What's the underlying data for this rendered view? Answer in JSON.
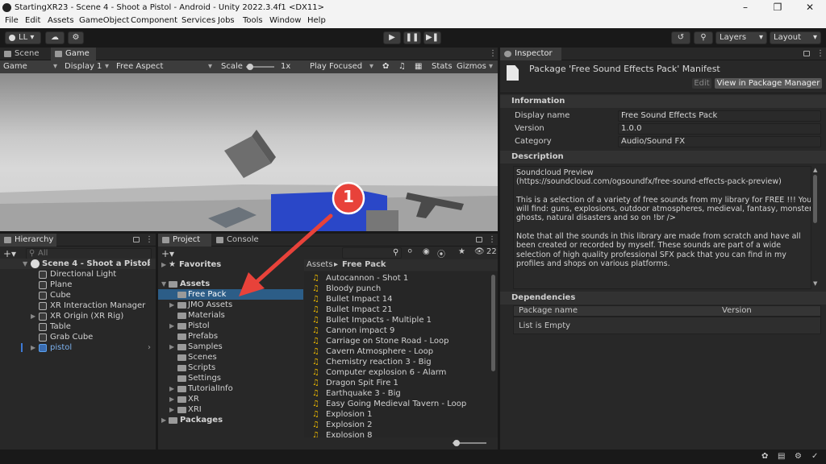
{
  "window": {
    "title": "StartingXR23 - Scene 4 - Shoot a Pistol - Android - Unity 2022.3.4f1 <DX11>"
  },
  "menu": [
    "File",
    "Edit",
    "Assets",
    "GameObject",
    "Component",
    "Services",
    "Jobs",
    "Tools",
    "Window",
    "Help"
  ],
  "toolbar": {
    "account": "LL",
    "layers": "Layers",
    "layout": "Layout"
  },
  "scene_tabs": {
    "scene": "Scene",
    "game": "Game"
  },
  "game_bar": {
    "mode": "Game",
    "display": "Display 1",
    "aspect": "Free Aspect",
    "scale_label": "Scale",
    "scale_value": "1x",
    "play_mode": "Play Focused",
    "stats": "Stats",
    "gizmos": "Gizmos"
  },
  "annotation": {
    "number": "1"
  },
  "hierarchy": {
    "tab": "Hierarchy",
    "search_placeholder": "All",
    "scene": "Scene 4 - Shoot a Pistol",
    "items": [
      "Directional Light",
      "Plane",
      "Cube",
      "XR Interaction Manager",
      "XR Origin (XR Rig)",
      "Table",
      "Grab Cube",
      "pistol"
    ]
  },
  "project": {
    "tabs": [
      "Project",
      "Console"
    ],
    "favorites": "Favorites",
    "assets": "Assets",
    "folders": [
      "Free Pack",
      "JMO Assets",
      "Materials",
      "Pistol",
      "Prefabs",
      "Samples",
      "Scenes",
      "Scripts",
      "Settings",
      "TutorialInfo",
      "XR",
      "XRI"
    ],
    "packages": "Packages",
    "breadcrumb": [
      "Assets",
      "Free Pack"
    ],
    "hidden_count": "22",
    "files": [
      "Autocannon - Shot 1",
      "Bloody punch",
      "Bullet Impact 14",
      "Bullet Impact 21",
      "Bullet Impacts - Multiple 1",
      "Cannon impact 9",
      "Carriage on Stone Road - Loop",
      "Cavern Atmosphere - Loop",
      "Chemistry reaction 3 - Big",
      "Computer explosion 6 - Alarm",
      "Dragon Spit Fire 1",
      "Earthquake 3 - Big",
      "Easy Going Medieval Tavern - Loop",
      "Explosion 1",
      "Explosion 2",
      "Explosion 8"
    ]
  },
  "inspector": {
    "tab": "Inspector",
    "header": "Package 'Free Sound Effects Pack' Manifest",
    "edit": "Edit",
    "view_pm": "View in Package Manager",
    "information": "Information",
    "fields": [
      {
        "label": "Display name",
        "value": "Free Sound Effects Pack"
      },
      {
        "label": "Version",
        "value": "1.0.0"
      },
      {
        "label": "Category",
        "value": "Audio/Sound FX"
      }
    ],
    "description_title": "Description",
    "description": [
      "Soundcloud Preview",
      "(https://soundcloud.com/ogsoundfx/free-sound-effects-pack-preview)",
      "",
      "This is a selection of a variety of free sounds from my library for FREE !!! You",
      "will find: guns, explosions, outdoor atmospheres, medieval, fantasy, monsters,",
      "ghosts, natural disasters and so on !br />",
      "",
      "Note that all the sounds in this library are made from scratch and have all",
      "been created or recorded by myself. These sounds are part of a wide",
      "selection of high quality professional SFX pack that you can find in my",
      "profiles and shops on various platforms."
    ],
    "dependencies_title": "Dependencies",
    "dep_col_name": "Package name",
    "dep_col_version": "Version",
    "dep_empty": "List is Empty"
  },
  "colors": {
    "selection": "#2c5d87",
    "accent_red": "#e8423a",
    "audio_icon": "#e8b600"
  }
}
